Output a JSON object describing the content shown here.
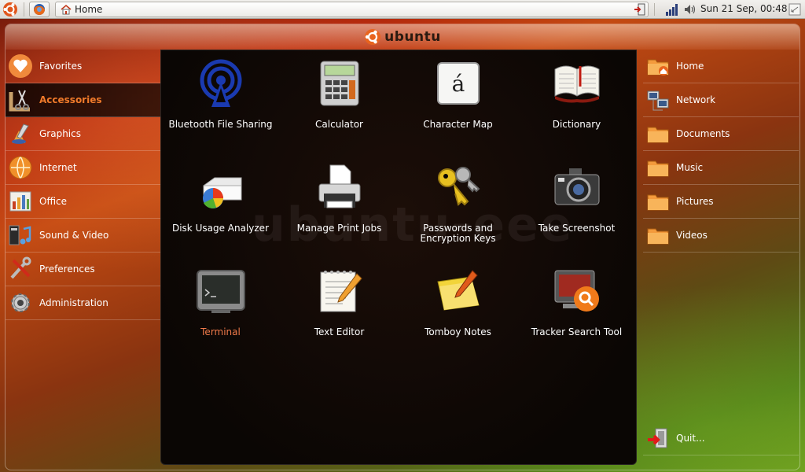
{
  "top_panel": {
    "task_title": "Home",
    "clock": "Sun 21 Sep, 00:48"
  },
  "header": {
    "brand": "ubuntu"
  },
  "categories": [
    {
      "label": "Favorites",
      "icon": "heart-icon"
    },
    {
      "label": "Accessories",
      "icon": "scissors-icon",
      "selected": true
    },
    {
      "label": "Graphics",
      "icon": "paintbrush-icon"
    },
    {
      "label": "Internet",
      "icon": "globe-icon"
    },
    {
      "label": "Office",
      "icon": "chart-icon"
    },
    {
      "label": "Sound & Video",
      "icon": "music-icon"
    },
    {
      "label": "Preferences",
      "icon": "tools-icon"
    },
    {
      "label": "Administration",
      "icon": "gear-icon"
    }
  ],
  "apps": [
    {
      "label": "Bluetooth File Sharing",
      "icon": "bluetooth-tower-icon"
    },
    {
      "label": "Calculator",
      "icon": "calculator-icon"
    },
    {
      "label": "Character Map",
      "icon": "character-map-icon"
    },
    {
      "label": "Dictionary",
      "icon": "book-icon"
    },
    {
      "label": "Disk Usage Analyzer",
      "icon": "disk-usage-icon"
    },
    {
      "label": "Manage Print Jobs",
      "icon": "printer-icon"
    },
    {
      "label": "Passwords and Encryption Keys",
      "icon": "keys-icon"
    },
    {
      "label": "Take Screenshot",
      "icon": "camera-icon"
    },
    {
      "label": "Terminal",
      "icon": "terminal-icon",
      "active": true
    },
    {
      "label": "Text Editor",
      "icon": "text-editor-icon"
    },
    {
      "label": "Tomboy Notes",
      "icon": "notes-icon"
    },
    {
      "label": "Tracker Search Tool",
      "icon": "search-tool-icon"
    }
  ],
  "watermark": "ubuntu-eee",
  "places": [
    {
      "label": "Home",
      "icon": "home-folder-icon"
    },
    {
      "label": "Network",
      "icon": "network-icon"
    },
    {
      "label": "Documents",
      "icon": "folder-icon"
    },
    {
      "label": "Music",
      "icon": "folder-icon"
    },
    {
      "label": "Pictures",
      "icon": "folder-icon"
    },
    {
      "label": "Videos",
      "icon": "folder-icon"
    }
  ],
  "quit_label": "Quit...",
  "colors": {
    "accent": "#f07a2a",
    "selected_bg": "#000000",
    "folder": "#f39a3c"
  }
}
